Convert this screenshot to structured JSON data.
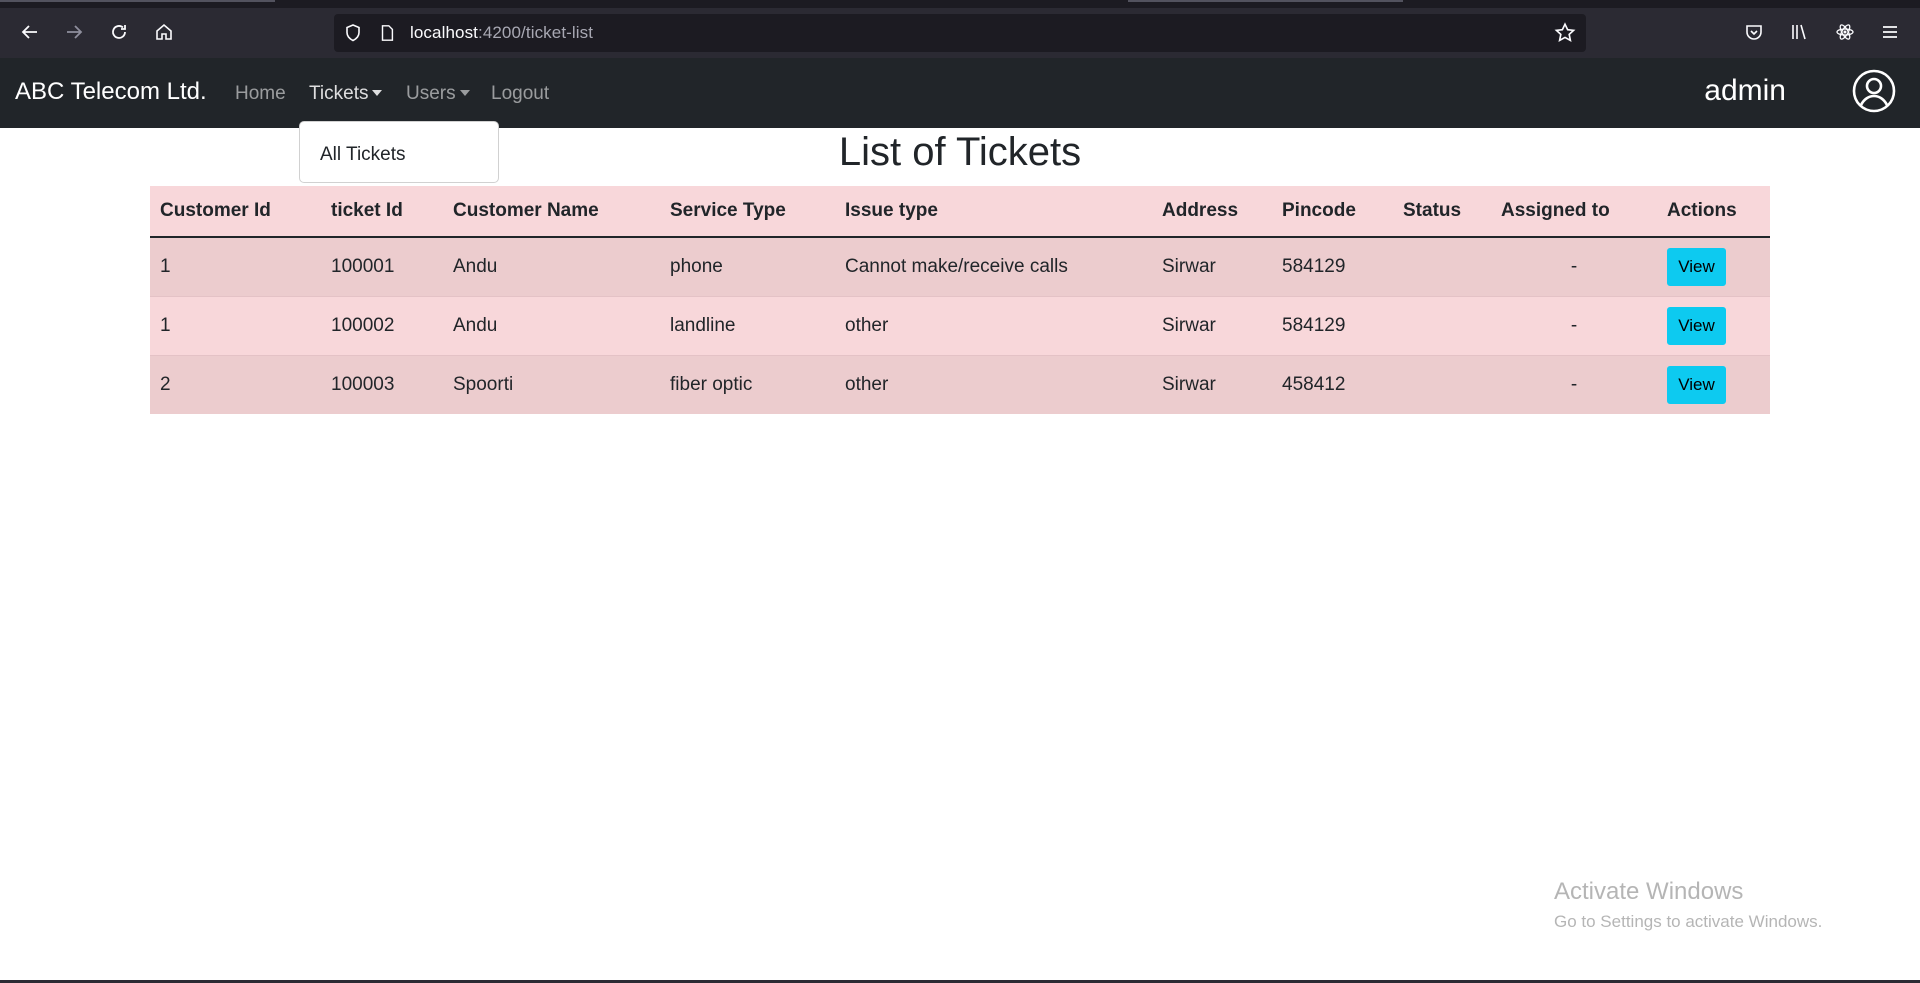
{
  "browser": {
    "url_host": "localhost",
    "url_rest": ":4200/ticket-list"
  },
  "navbar": {
    "brand": "ABC Telecom Ltd.",
    "links": [
      {
        "label": "Home"
      },
      {
        "label": "Tickets"
      },
      {
        "label": "Users"
      },
      {
        "label": "Logout"
      }
    ],
    "user": "admin"
  },
  "dropdown": {
    "items": [
      {
        "label": "All Tickets"
      }
    ]
  },
  "page": {
    "title": "List of Tickets"
  },
  "table": {
    "headers": [
      "Customer Id",
      "ticket Id",
      "Customer Name",
      "Service Type",
      "Issue type",
      "Address",
      "Pincode",
      "Status",
      "Assigned to",
      "Actions"
    ],
    "rows": [
      [
        "1",
        "100001",
        "Andu",
        "phone",
        "Cannot make/receive calls",
        "Sirwar",
        "584129",
        "",
        "-",
        "View"
      ],
      [
        "1",
        "100002",
        "Andu",
        "landline",
        "other",
        "Sirwar",
        "584129",
        "",
        "-",
        "View"
      ],
      [
        "2",
        "100003",
        "Spoorti",
        "fiber optic",
        "other",
        "Sirwar",
        "458412",
        "",
        "-",
        "View"
      ]
    ]
  },
  "watermark": {
    "title": "Activate Windows",
    "subtitle": "Go to Settings to activate Windows."
  },
  "colors": {
    "navbar_bg": "#212529",
    "table_bg": "#f8d7da",
    "view_button": "#0dcaf0"
  }
}
